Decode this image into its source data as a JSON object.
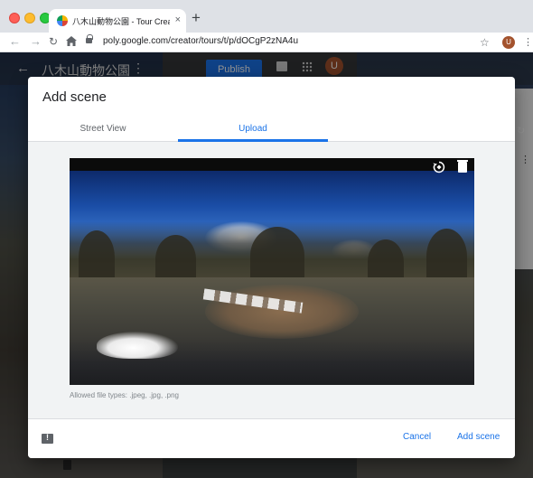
{
  "browser": {
    "tab_title": "八木山動物公園 - Tour Creator",
    "tab_close": "×",
    "new_tab": "+",
    "url": "poly.google.com/creator/tours/t/p/dOCgP2zNA4u",
    "profile_initial": "U"
  },
  "app": {
    "title": "八木山動物公園",
    "publish_label": "Publish",
    "avatar_initial": "U"
  },
  "dialog": {
    "title": "Add scene",
    "tabs": [
      {
        "label": "Street View",
        "active": false
      },
      {
        "label": "Upload",
        "active": true
      }
    ],
    "file_types_note": "Allowed file types: .jpeg, .jpg, .png",
    "cancel_label": "Cancel",
    "add_label": "Add scene"
  },
  "colors": {
    "accent": "#1a73e8",
    "overlay": "rgba(0,0,0,0.42)"
  },
  "icons": {
    "rotate": "rotate-icon",
    "delete": "trash-icon",
    "feedback": "feedback-icon"
  }
}
